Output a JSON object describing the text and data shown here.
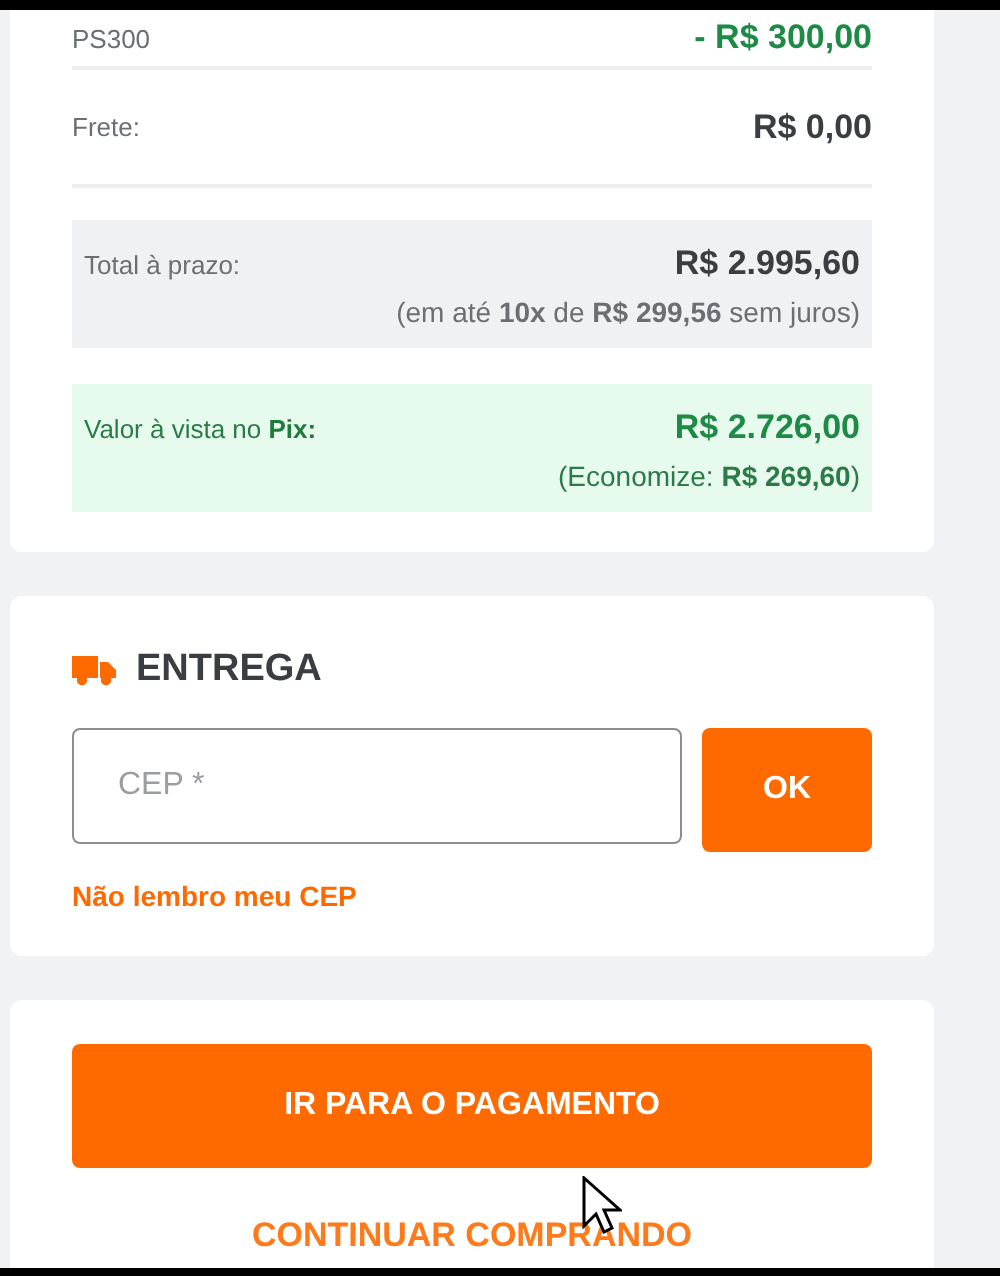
{
  "summary": {
    "rows": [
      {
        "label": "PS300",
        "value": "- R$ 300,00",
        "kind": "discount"
      },
      {
        "label": "Frete:",
        "value": "R$ 0,00",
        "kind": "plain"
      }
    ],
    "installment": {
      "label": "Total à prazo:",
      "value": "R$ 2.995,60",
      "note": "(em até **10x** de **R$ 299,56** sem juros)"
    },
    "pix": {
      "label": "Valor à vista no **Pix:**",
      "value": "R$ 2.726,00",
      "note": "(Economize: **R$ 269,60**)"
    }
  },
  "delivery": {
    "title": "ENTREGA",
    "placeholder": "CEP *",
    "button": "OK",
    "link": "Não lembro meu CEP"
  },
  "actions": {
    "primary": "IR PARA O PAGAMENTO",
    "secondary": "CONTINUAR COMPRANDO"
  }
}
